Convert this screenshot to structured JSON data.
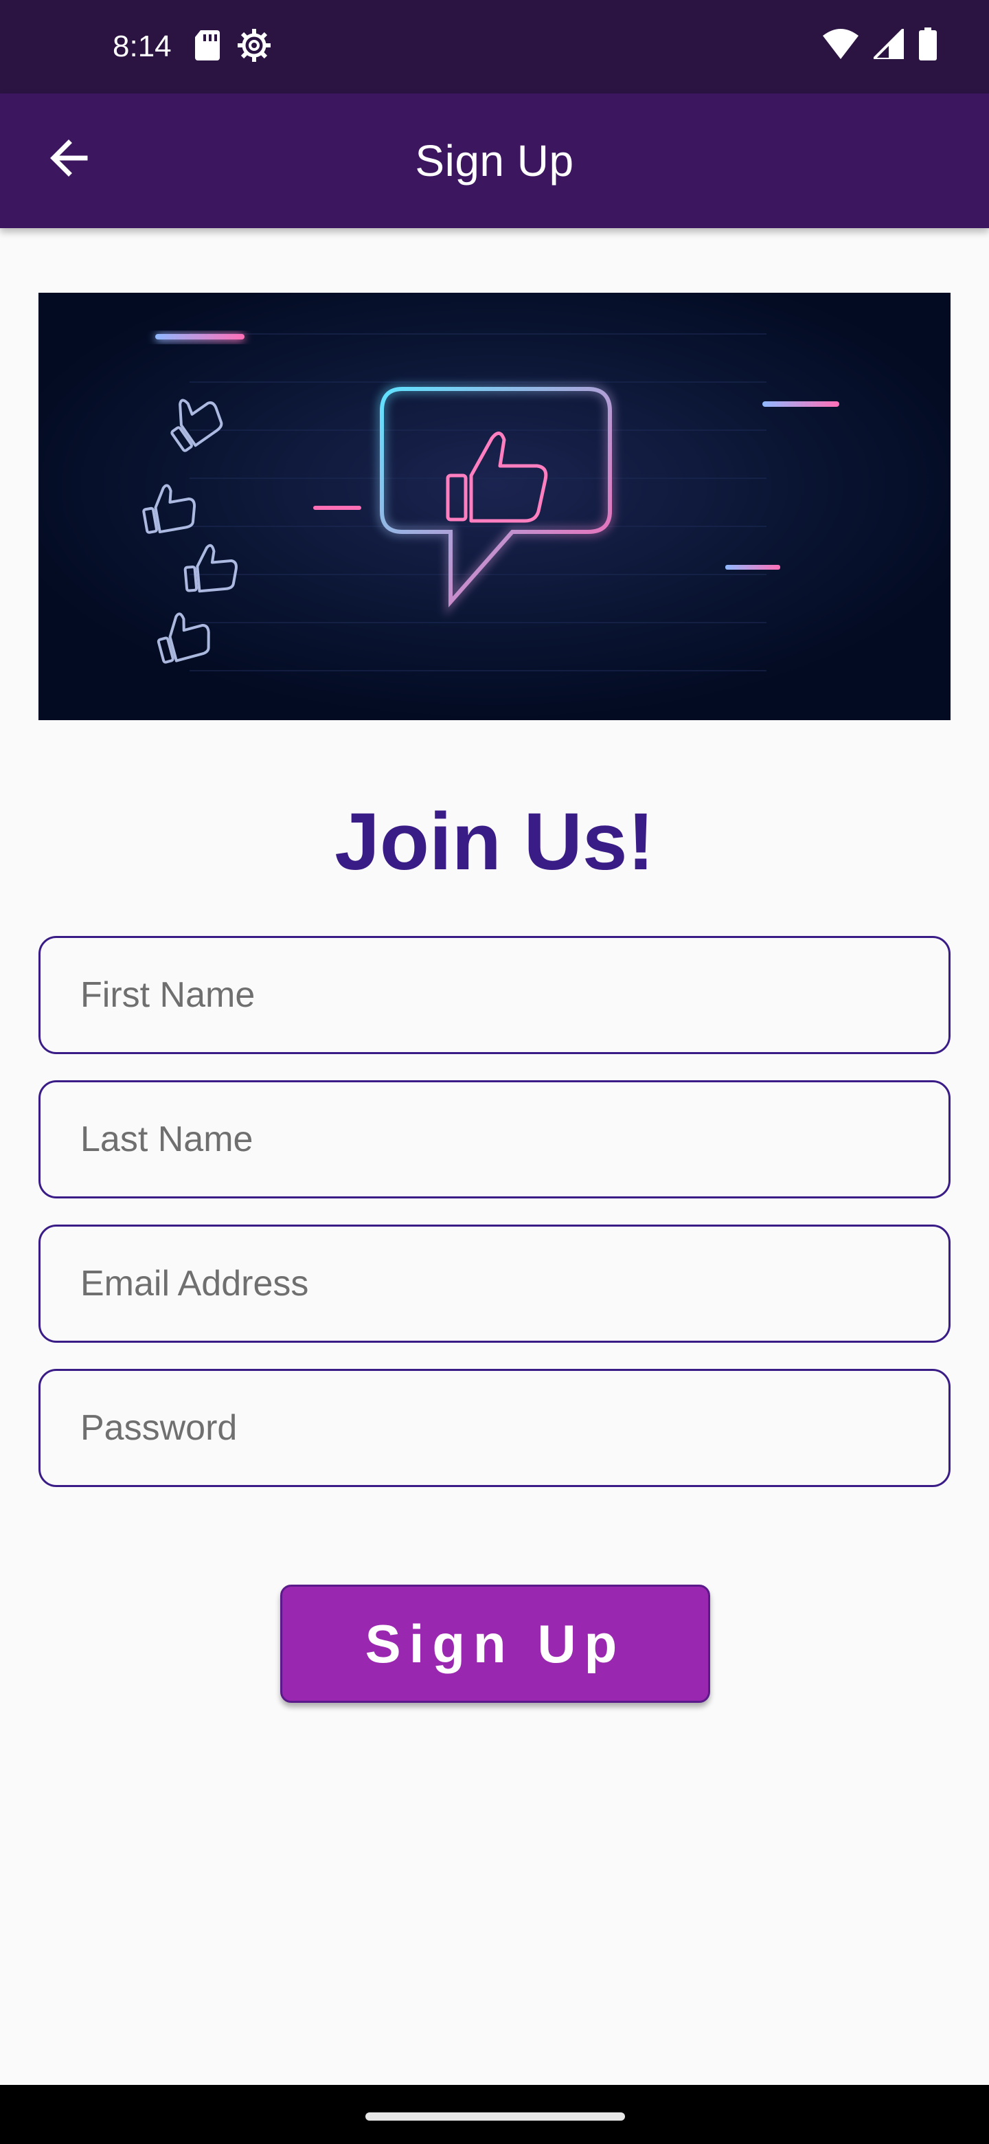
{
  "status_bar": {
    "time": "8:14",
    "left_icons": [
      "sd-card-icon",
      "settings-gear-icon"
    ],
    "right_icons": [
      "wifi-icon",
      "cellular-signal-icon",
      "battery-icon"
    ]
  },
  "app_bar": {
    "title": "Sign Up",
    "back_icon": "arrow-left-icon"
  },
  "banner": {
    "description_icons": [
      "neon-thumbs-up-icon",
      "speech-bubble-icon"
    ]
  },
  "headline": "Join Us!",
  "form": {
    "first_name": {
      "placeholder": "First Name",
      "value": ""
    },
    "last_name": {
      "placeholder": "Last Name",
      "value": ""
    },
    "email": {
      "placeholder": "Email Address",
      "value": ""
    },
    "password": {
      "placeholder": "Password",
      "value": ""
    }
  },
  "actions": {
    "sign_up_label": "Sign Up"
  },
  "colors": {
    "status_bar": "#2b1342",
    "app_bar": "#3d1660",
    "headline": "#3a1c86",
    "field_border": "#3a1c86",
    "button": "#9a27b0",
    "background": "#fafafa"
  }
}
